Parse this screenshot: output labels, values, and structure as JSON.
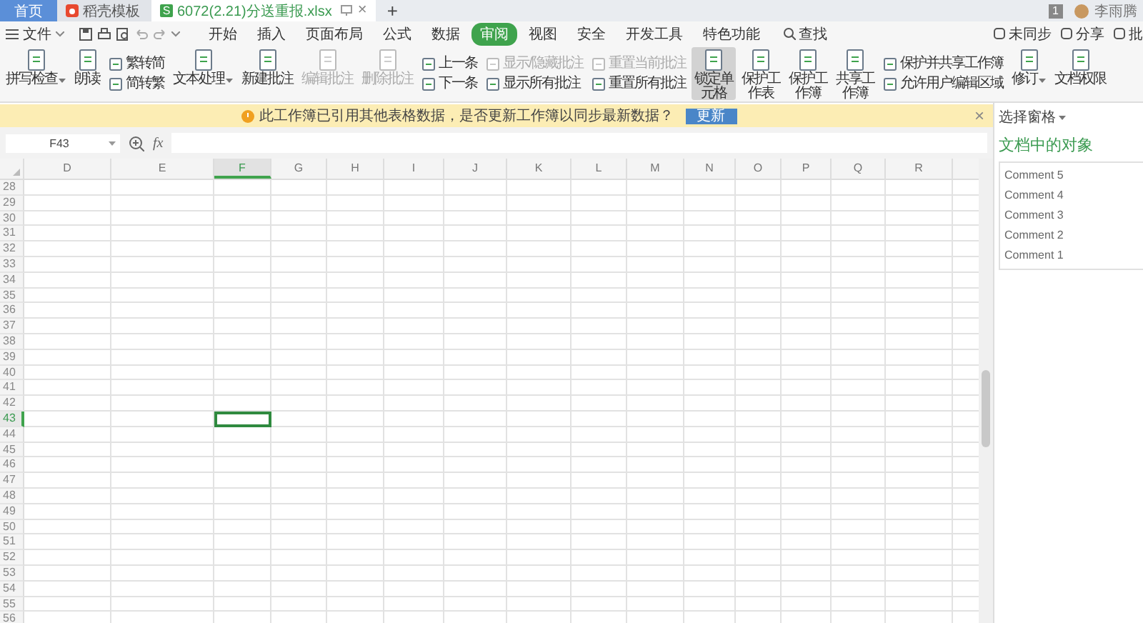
{
  "tabs": [
    {
      "kind": "home",
      "label": "首页",
      "selected": false
    },
    {
      "kind": "docer",
      "label": "稻壳模板",
      "selected": false
    },
    {
      "kind": "sheet",
      "label": "6072(2.21)分送重报.xlsx",
      "badge": "S",
      "close": "×",
      "selected": true
    }
  ],
  "new_tab": "+",
  "account": {
    "badge": "1",
    "user": "李雨腾"
  },
  "menu": {
    "file": "文件",
    "items": [
      {
        "label": "开始",
        "selected": false
      },
      {
        "label": "插入",
        "selected": false
      },
      {
        "label": "页面布局",
        "selected": false
      },
      {
        "label": "公式",
        "selected": false
      },
      {
        "label": "数据",
        "selected": false
      },
      {
        "label": "审阅",
        "selected": true
      },
      {
        "label": "视图",
        "selected": false
      },
      {
        "label": "安全",
        "selected": false
      },
      {
        "label": "开发工具",
        "selected": false
      },
      {
        "label": "特色功能",
        "selected": false
      }
    ],
    "search": "查找",
    "right": [
      "未同步",
      "分享",
      "批"
    ]
  },
  "ribbon": [
    {
      "kind": "large",
      "label": "拼写检查",
      "dropdown": true,
      "disabled": false,
      "selected": false
    },
    {
      "kind": "large",
      "label": "朗读",
      "dropdown": false,
      "disabled": false,
      "selected": false
    },
    {
      "kind": "stack",
      "items": [
        {
          "label": "繁转简",
          "disabled": false
        },
        {
          "label": "简转繁",
          "disabled": false
        }
      ]
    },
    {
      "kind": "large",
      "label": "文本处理",
      "dropdown": true,
      "disabled": false,
      "selected": false
    },
    {
      "kind": "large",
      "label": "新建批注",
      "dropdown": false,
      "disabled": false,
      "selected": false
    },
    {
      "kind": "large",
      "label": "编辑批注",
      "dropdown": false,
      "disabled": true,
      "selected": false
    },
    {
      "kind": "large",
      "label": "删除批注",
      "dropdown": false,
      "disabled": true,
      "selected": false
    },
    {
      "kind": "stack",
      "items": [
        {
          "label": "上一条",
          "disabled": false
        },
        {
          "label": "下一条",
          "disabled": false
        }
      ]
    },
    {
      "kind": "stack",
      "items": [
        {
          "label": "显示/隐藏批注",
          "disabled": true
        },
        {
          "label": "显示所有批注",
          "disabled": false
        }
      ]
    },
    {
      "kind": "stack",
      "items": [
        {
          "label": "重置当前批注",
          "disabled": true
        },
        {
          "label": "重置所有批注",
          "disabled": false
        }
      ]
    },
    {
      "kind": "large",
      "label": "锁定单元格",
      "dropdown": false,
      "disabled": false,
      "selected": true
    },
    {
      "kind": "large",
      "label": "保护工作表",
      "dropdown": false,
      "disabled": false,
      "selected": false
    },
    {
      "kind": "large",
      "label": "保护工作簿",
      "dropdown": false,
      "disabled": false,
      "selected": false
    },
    {
      "kind": "large",
      "label": "共享工作簿",
      "dropdown": false,
      "disabled": false,
      "selected": false
    },
    {
      "kind": "stack",
      "items": [
        {
          "label": "保护并共享工作簿",
          "disabled": false
        },
        {
          "label": "允许用户编辑区域",
          "disabled": false
        }
      ]
    },
    {
      "kind": "large",
      "label": "修订",
      "dropdown": true,
      "disabled": false,
      "selected": false
    },
    {
      "kind": "large",
      "label": "文档权限",
      "dropdown": false,
      "disabled": false,
      "selected": false
    }
  ],
  "notice": {
    "text": "此工作簿已引用其他表格数据，是否更新工作簿以同步最新数据？",
    "button": "更新",
    "close": "×"
  },
  "name_box": "F43",
  "formula": {
    "fx": "fx"
  },
  "sheet": {
    "columns": [
      {
        "label": "D",
        "selected": false
      },
      {
        "label": "E",
        "selected": false
      },
      {
        "label": "F",
        "selected": true
      },
      {
        "label": "G",
        "selected": false
      },
      {
        "label": "H",
        "selected": false
      },
      {
        "label": "I",
        "selected": false
      },
      {
        "label": "J",
        "selected": false
      },
      {
        "label": "K",
        "selected": false
      },
      {
        "label": "L",
        "selected": false
      },
      {
        "label": "M",
        "selected": false
      },
      {
        "label": "N",
        "selected": false
      },
      {
        "label": "O",
        "selected": false
      },
      {
        "label": "P",
        "selected": false
      },
      {
        "label": "Q",
        "selected": false
      },
      {
        "label": "R",
        "selected": false
      }
    ],
    "rows": [
      {
        "label": "28",
        "selected": false
      },
      {
        "label": "29",
        "selected": false
      },
      {
        "label": "30",
        "selected": false
      },
      {
        "label": "31",
        "selected": false
      },
      {
        "label": "32",
        "selected": false
      },
      {
        "label": "33",
        "selected": false
      },
      {
        "label": "34",
        "selected": false
      },
      {
        "label": "35",
        "selected": false
      },
      {
        "label": "36",
        "selected": false
      },
      {
        "label": "37",
        "selected": false
      },
      {
        "label": "38",
        "selected": false
      },
      {
        "label": "39",
        "selected": false
      },
      {
        "label": "40",
        "selected": false
      },
      {
        "label": "41",
        "selected": false
      },
      {
        "label": "42",
        "selected": false
      },
      {
        "label": "43",
        "selected": true
      },
      {
        "label": "44",
        "selected": false
      },
      {
        "label": "45",
        "selected": false
      },
      {
        "label": "46",
        "selected": false
      },
      {
        "label": "47",
        "selected": false
      },
      {
        "label": "48",
        "selected": false
      },
      {
        "label": "49",
        "selected": false
      },
      {
        "label": "50",
        "selected": false
      },
      {
        "label": "51",
        "selected": false
      },
      {
        "label": "52",
        "selected": false
      },
      {
        "label": "53",
        "selected": false
      },
      {
        "label": "54",
        "selected": false
      },
      {
        "label": "55",
        "selected": false
      },
      {
        "label": "56",
        "selected": false
      }
    ]
  },
  "pane": {
    "title": "选择窗格",
    "heading": "文档中的对象",
    "objects": [
      "Comment 5",
      "Comment 4",
      "Comment 3",
      "Comment 2",
      "Comment 1"
    ]
  }
}
